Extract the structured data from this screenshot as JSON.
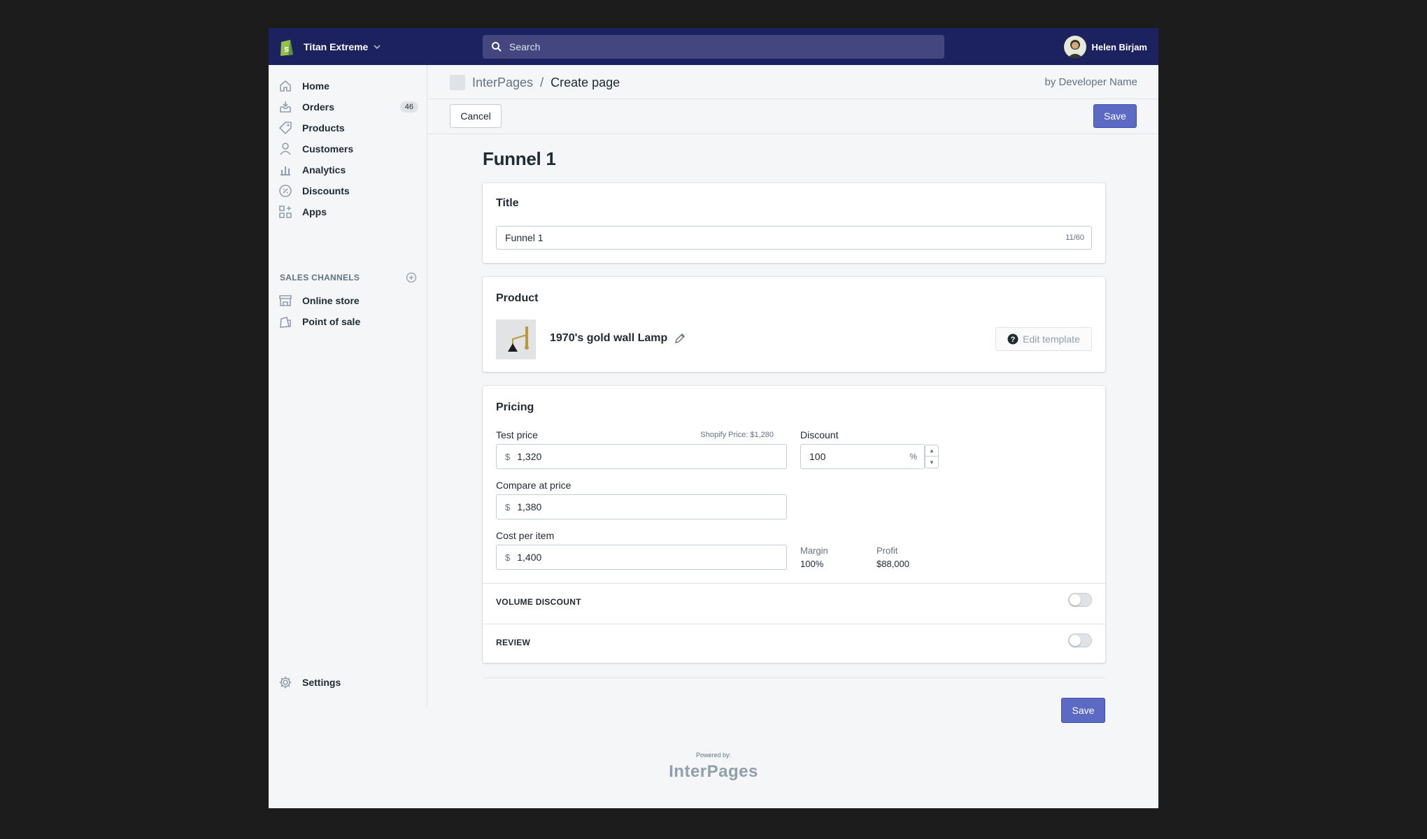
{
  "topbar": {
    "store_name": "Titan Extreme",
    "search_placeholder": "Search",
    "user_name": "Helen Birjam"
  },
  "sidebar": {
    "items": [
      {
        "label": "Home",
        "icon": "home-icon"
      },
      {
        "label": "Orders",
        "icon": "orders-icon",
        "badge": "46"
      },
      {
        "label": "Products",
        "icon": "tag-icon"
      },
      {
        "label": "Customers",
        "icon": "person-icon"
      },
      {
        "label": "Analytics",
        "icon": "bar-chart-icon"
      },
      {
        "label": "Discounts",
        "icon": "discount-icon"
      },
      {
        "label": "Apps",
        "icon": "apps-icon"
      }
    ],
    "sales_channels_heading": "SALES CHANNELS",
    "channels": [
      {
        "label": "Online store",
        "icon": "store-icon"
      },
      {
        "label": "Point of sale",
        "icon": "pos-icon"
      }
    ],
    "settings_label": "Settings"
  },
  "header": {
    "app_name": "InterPages",
    "separator": "/",
    "current_page": "Create page",
    "byline": "by Developer Name",
    "cancel_label": "Cancel",
    "save_label": "Save"
  },
  "main": {
    "page_title": "Funnel 1",
    "title_card": {
      "heading": "Title",
      "value": "Funnel 1",
      "char_count": "11/60"
    },
    "product_card": {
      "heading": "Product",
      "product_name": "1970's gold wall Lamp",
      "edit_template_label": "Edit template"
    },
    "pricing_card": {
      "heading": "Pricing",
      "test_price_label": "Test price",
      "shopify_price_note": "Shopify Price: $1,280",
      "currency": "$",
      "test_price": "1,320",
      "discount_label": "Discount",
      "discount_value": "100",
      "discount_unit": "%",
      "compare_label": "Compare at price",
      "compare_price": "1,380",
      "cost_label": "Cost per item",
      "cost_price": "1,400",
      "margin_label": "Margin",
      "margin_value": "100%",
      "profit_label": "Profit",
      "profit_value": "$88,000",
      "volume_discount_label": "VOLUME DISCOUNT",
      "volume_discount_on": false,
      "review_label": "REVIEW",
      "review_on": false
    },
    "bottom_save_label": "Save"
  },
  "footer": {
    "powered_by": "Powered by:",
    "brand": "InterPages"
  },
  "colors": {
    "topbar": "#1c2260",
    "primary": "#5c6ac4",
    "background": "#f4f6f8"
  }
}
